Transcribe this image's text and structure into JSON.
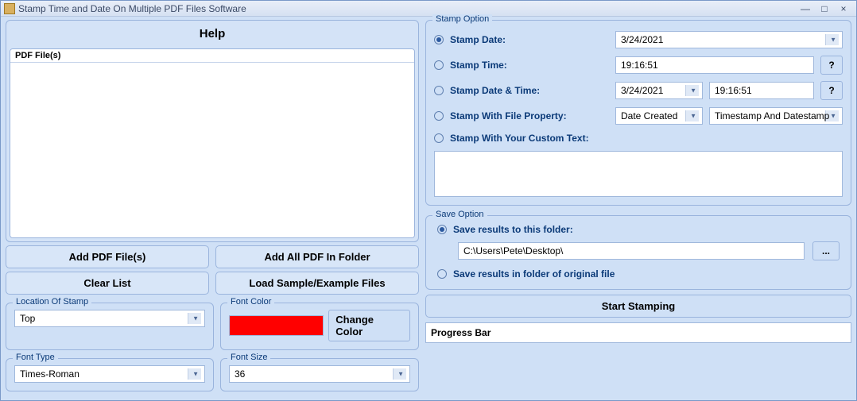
{
  "window": {
    "title": "Stamp Time and Date On Multiple PDF Files Software"
  },
  "left": {
    "help_label": "Help",
    "pdf_header": "PDF File(s)",
    "buttons": {
      "add_pdf": "Add PDF File(s)",
      "add_folder": "Add All PDF In Folder",
      "clear": "Clear List",
      "load_sample": "Load Sample/Example Files"
    },
    "location": {
      "title": "Location Of Stamp",
      "value": "Top"
    },
    "font_color": {
      "title": "Font Color",
      "hex": "#ff0000",
      "change_label": "Change Color"
    },
    "font_type": {
      "title": "Font Type",
      "value": "Times-Roman"
    },
    "font_size": {
      "title": "Font Size",
      "value": "36"
    }
  },
  "stamp": {
    "title": "Stamp Option",
    "opt_date_label": "Stamp Date:",
    "date_value": "3/24/2021",
    "opt_time_label": "Stamp Time:",
    "time_value": "19:16:51",
    "opt_datetime_label": "Stamp Date & Time:",
    "dt_date": "3/24/2021",
    "dt_time": "19:16:51",
    "opt_prop_label": "Stamp With File Property:",
    "prop_left": "Date Created",
    "prop_right": "Timestamp And Datestamp",
    "opt_custom_label": "Stamp With Your Custom Text:",
    "help_q": "?"
  },
  "save": {
    "title": "Save Option",
    "radio1": "Save results to this folder:",
    "folder": "C:\\Users\\Pete\\Desktop\\",
    "browse": "...",
    "radio2": "Save results in folder of original file"
  },
  "action": {
    "start": "Start Stamping",
    "progress": "Progress Bar"
  }
}
